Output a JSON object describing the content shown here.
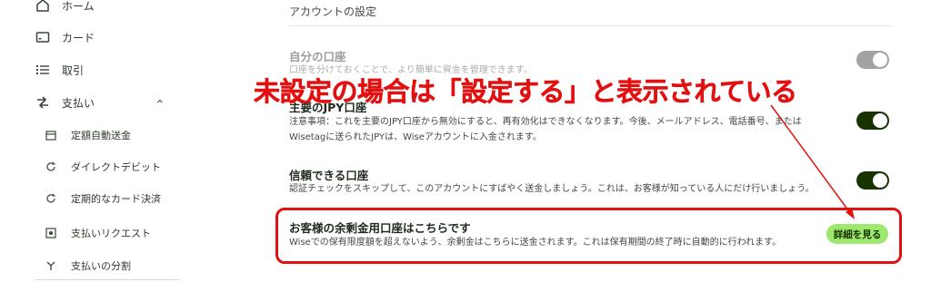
{
  "sidebar": {
    "items": [
      {
        "label": "ホーム",
        "icon": "home-icon"
      },
      {
        "label": "カード",
        "icon": "card-icon"
      },
      {
        "label": "取引",
        "icon": "list-icon"
      },
      {
        "label": "支払い",
        "icon": "transfer-icon"
      }
    ],
    "sub_items": [
      {
        "label": "定額自動送金",
        "icon": "calendar-icon"
      },
      {
        "label": "ダイレクトデビット",
        "icon": "refresh-icon"
      },
      {
        "label": "定期的なカード決済",
        "icon": "redo-icon"
      },
      {
        "label": "支払いリクエスト",
        "icon": "request-icon"
      },
      {
        "label": "支払いの分割",
        "icon": "split-icon"
      }
    ]
  },
  "main": {
    "section_title": "アカウントの設定",
    "rows": [
      {
        "title": "自分の口座",
        "desc": "口座を分けておくことで、より簡単に資金を管理できます。",
        "toggle": "off"
      },
      {
        "title": "主要のJPY口座",
        "desc_line1": "注意事項：これを主要のJPY口座から無効にすると、再有効化はできなくなります。今後、メールアドレス、電話番号、または",
        "desc_line2": "Wisetagに送られたJPYは、Wiseアカウントに入金されます。",
        "toggle": "on"
      },
      {
        "title": "信頼できる口座",
        "desc": "認証チェックをスキップして、このアカウントにすばやく送金しましょう。これは、お客様が知っている人にだけ行いましょう。",
        "toggle": "on"
      },
      {
        "title": "お客様の余剰金用口座はこちらです",
        "desc": "Wiseでの保有限度額を超えないよう、余剰金はこちらに送金されます。これは保有期間の終了時に自動的に行われます。",
        "button": "詳細を見る"
      }
    ]
  },
  "annotation": {
    "text": "未設定の場合は「設定する」と表示されている",
    "color": "#e21010"
  },
  "colors": {
    "accent_green": "#9fe870",
    "dark_green": "#163300",
    "toggle_off": "#8c8c8c"
  }
}
